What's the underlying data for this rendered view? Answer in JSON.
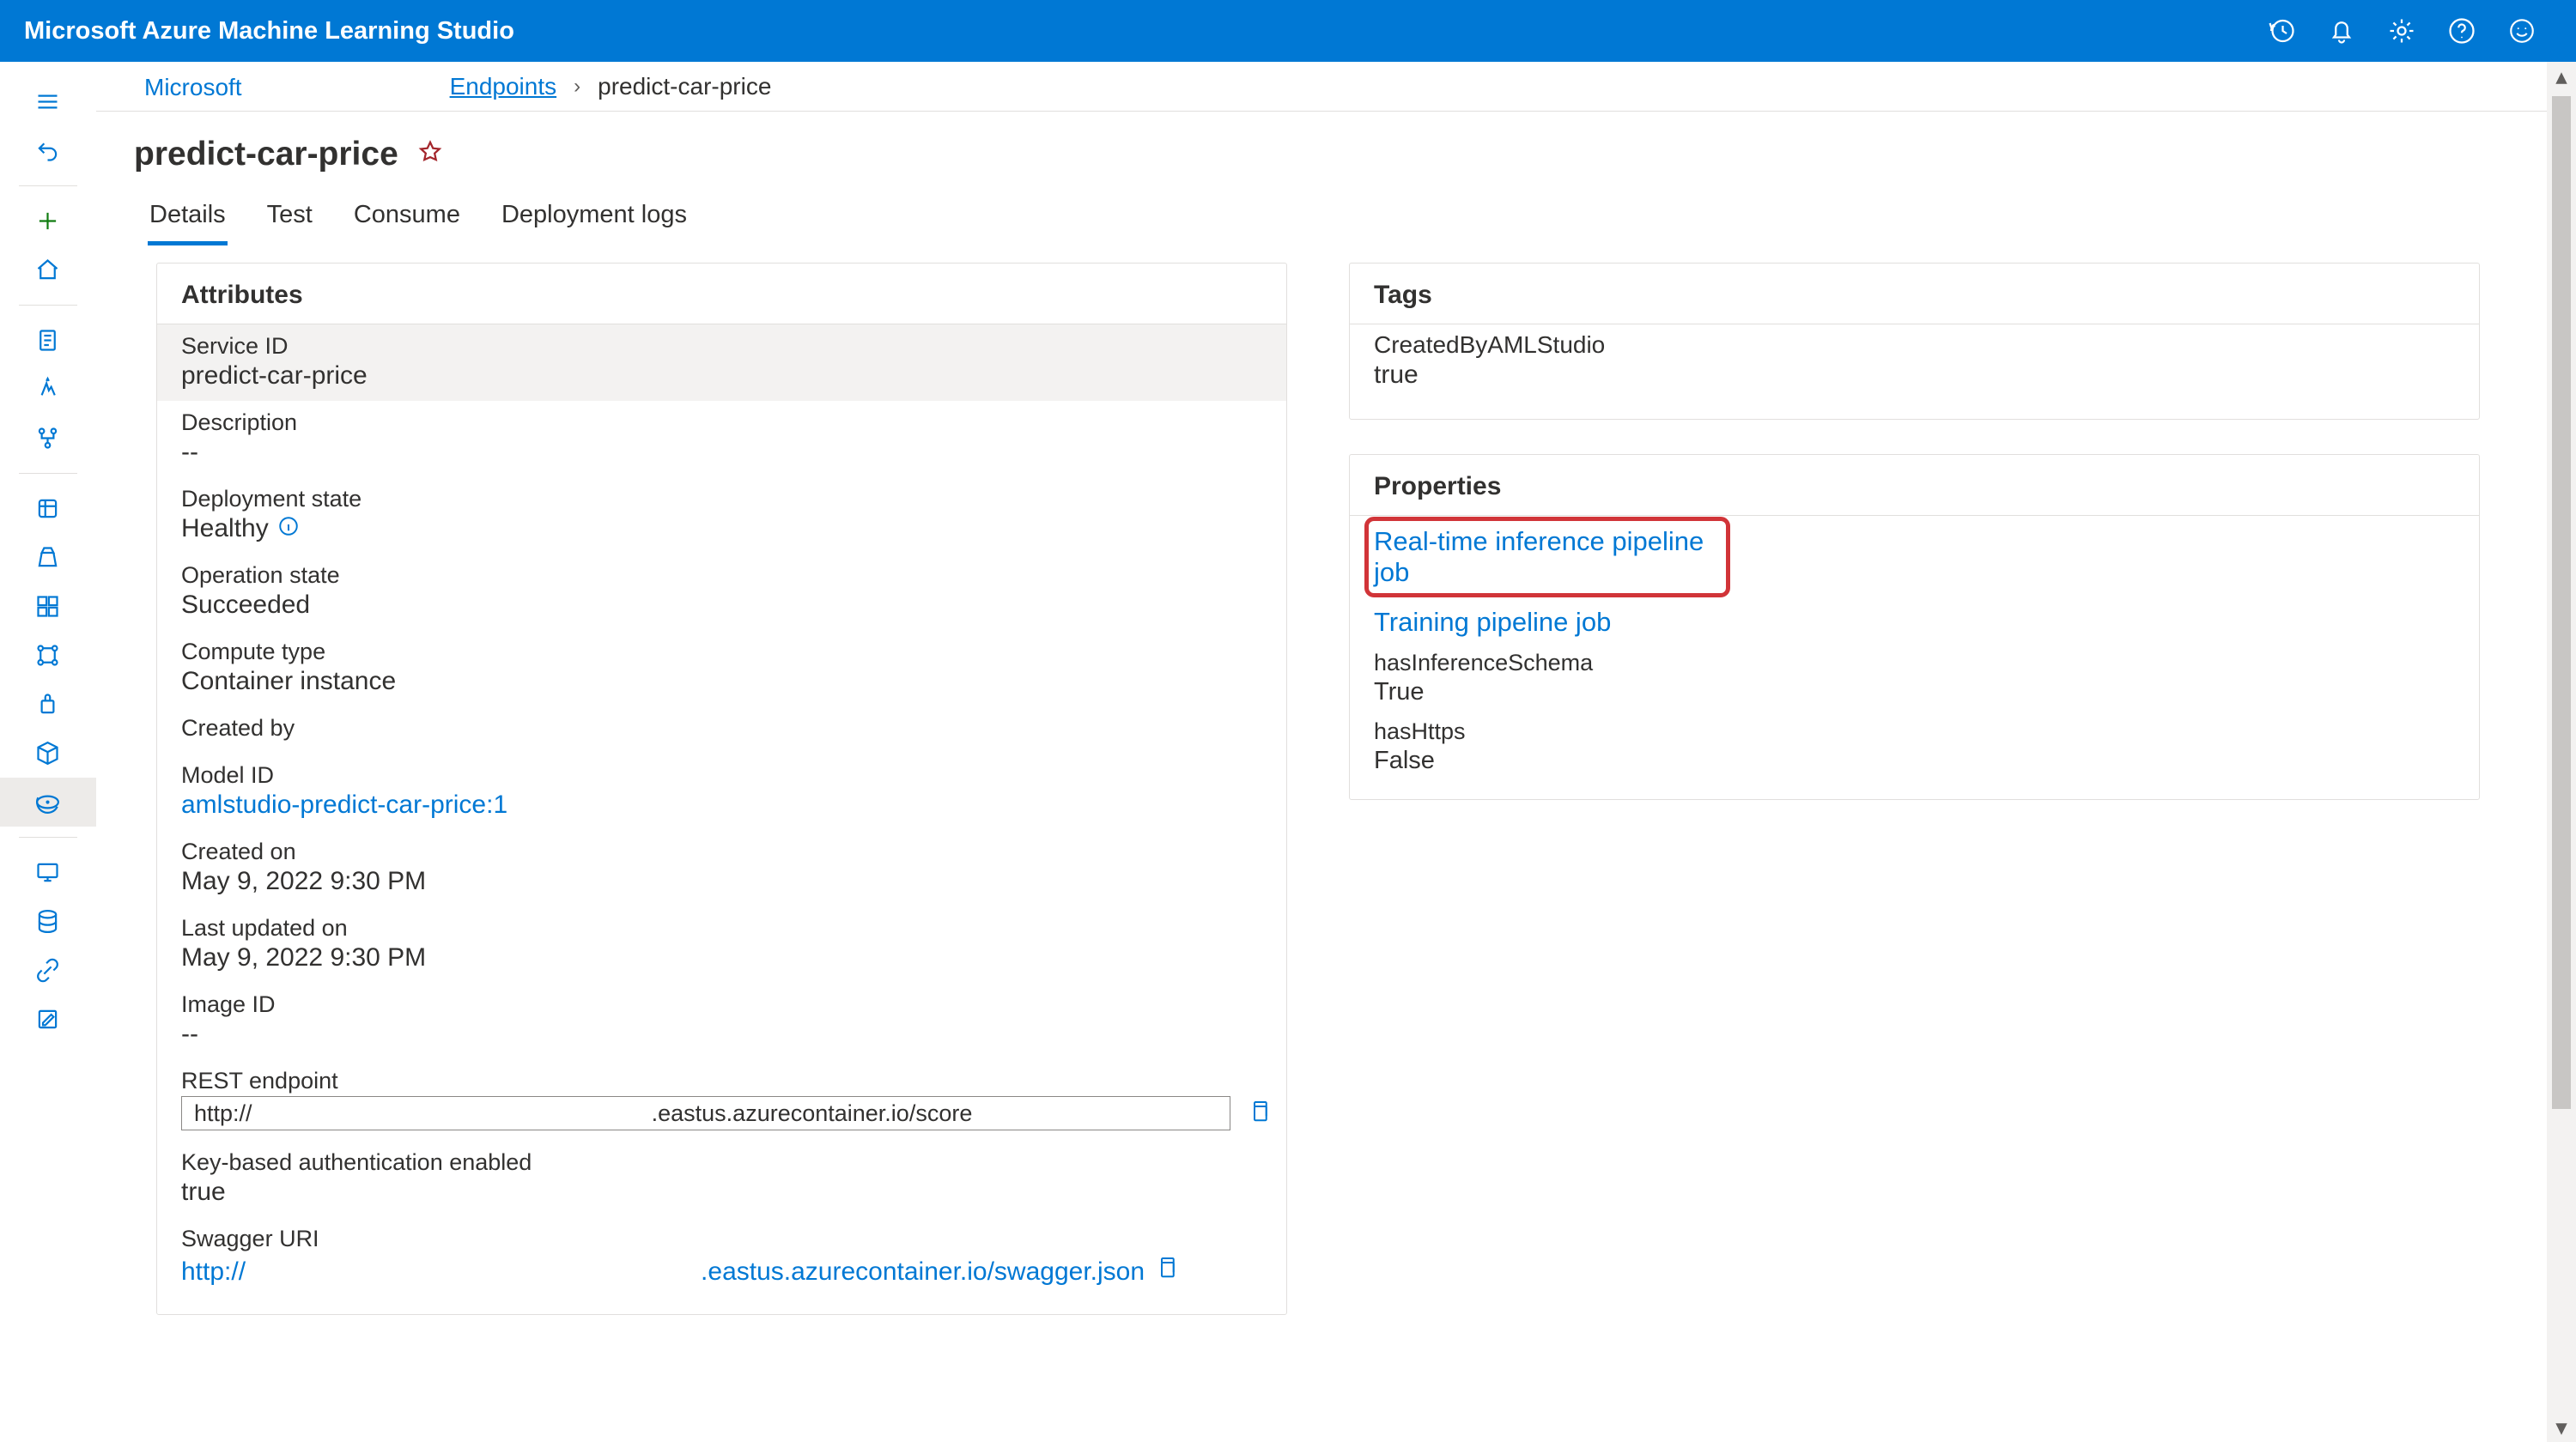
{
  "app_title": "Microsoft Azure Machine Learning Studio",
  "breadcrumb": {
    "workspace": "Microsoft",
    "section": "Endpoints",
    "current": "predict-car-price"
  },
  "page_title": "predict-car-price",
  "tabs": [
    {
      "label": "Details",
      "active": true
    },
    {
      "label": "Test",
      "active": false
    },
    {
      "label": "Consume",
      "active": false
    },
    {
      "label": "Deployment logs",
      "active": false
    }
  ],
  "attributes_panel": {
    "title": "Attributes",
    "items": {
      "service_id": {
        "label": "Service ID",
        "value": "predict-car-price"
      },
      "description": {
        "label": "Description",
        "value": "--"
      },
      "deployment_state": {
        "label": "Deployment state",
        "value": "Healthy"
      },
      "operation_state": {
        "label": "Operation state",
        "value": "Succeeded"
      },
      "compute_type": {
        "label": "Compute type",
        "value": "Container instance"
      },
      "created_by": {
        "label": "Created by",
        "value": ""
      },
      "model_id": {
        "label": "Model ID",
        "value": "amlstudio-predict-car-price:1"
      },
      "created_on": {
        "label": "Created on",
        "value": "May 9, 2022 9:30 PM"
      },
      "last_updated_on": {
        "label": "Last updated on",
        "value": "May 9, 2022 9:30 PM"
      },
      "image_id": {
        "label": "Image ID",
        "value": "--"
      },
      "rest_endpoint": {
        "label": "REST endpoint",
        "value": "http://                                                              .eastus.azurecontainer.io/score"
      },
      "key_auth": {
        "label": "Key-based authentication enabled",
        "value": "true"
      },
      "swagger_uri": {
        "label": "Swagger URI",
        "seg1": "http://",
        "seg2": ".eastus.azurecontainer.io/swagger.json"
      }
    }
  },
  "tags_panel": {
    "title": "Tags",
    "items": [
      {
        "k": "CreatedByAMLStudio",
        "v": "true"
      }
    ]
  },
  "properties_panel": {
    "title": "Properties",
    "links": [
      {
        "label": "Real-time inference pipeline job",
        "highlight": true
      },
      {
        "label": "Training pipeline job",
        "highlight": false
      }
    ],
    "kv": [
      {
        "k": "hasInferenceSchema",
        "v": "True"
      },
      {
        "k": "hasHttps",
        "v": "False"
      }
    ]
  },
  "topbar_icons": [
    "history-icon",
    "bell-icon",
    "gear-icon",
    "help-icon",
    "smile-icon"
  ],
  "leftnav_icons": [
    "menu-icon",
    "undo-icon",
    "sep",
    "plus-icon",
    "home-icon",
    "sep",
    "notebook-icon",
    "flow-icon",
    "graph-icon",
    "sep",
    "datastore-icon",
    "experiment-icon",
    "component-icon",
    "pipeline2-icon",
    "environment-icon",
    "model-icon",
    "endpoint-icon",
    "sep",
    "compute-icon",
    "data-icon",
    "link-icon",
    "edit-icon"
  ]
}
